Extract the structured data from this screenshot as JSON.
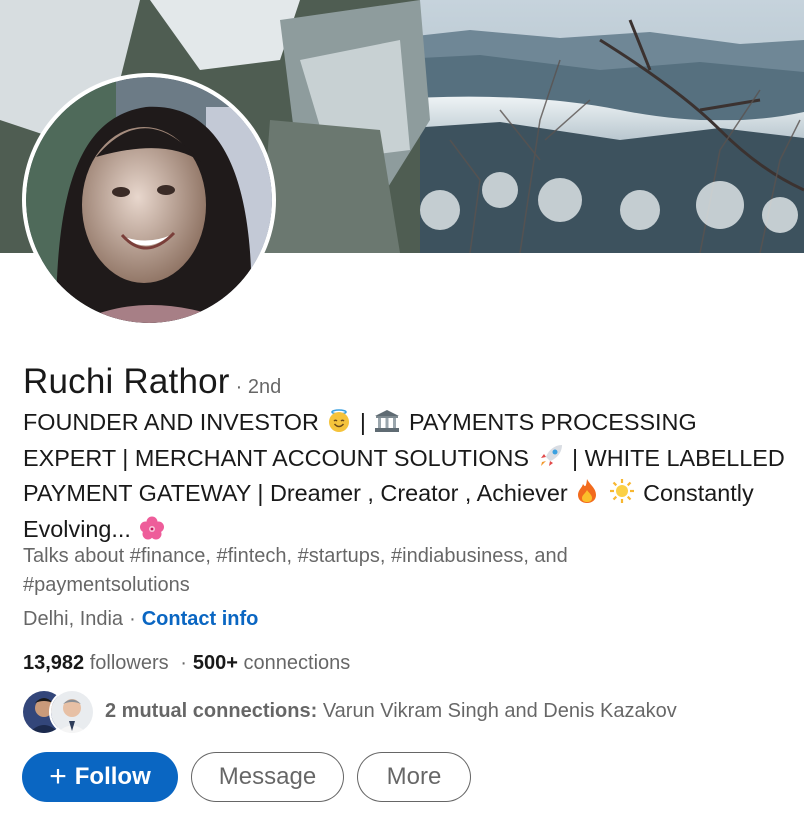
{
  "profile": {
    "name": "Ruchi Rathor",
    "degree": "· 2nd",
    "headline": {
      "part1": "FOUNDER AND INVESTOR",
      "part2": "|",
      "part3": "PAYMENTS PROCESSING EXPERT | MERCHANT ACCOUNT SOLUTIONS",
      "part4": "| WHITE LABELLED PAYMENT GATEWAY | Dreamer , Creator , Achiever",
      "part5": "Constantly Evolving...",
      "emojis": [
        "smiling-face-with-halo",
        "bank",
        "rocket",
        "fire",
        "sun",
        "hibiscus"
      ]
    },
    "talks_about": "Talks about #finance, #fintech, #startups, #indiabusiness, and #paymentsolutions",
    "location": "Delhi, India",
    "separator": "·",
    "contact_info": "Contact info",
    "followers_count": "13,982",
    "followers_label": "followers",
    "stats_separator": "·",
    "connections_count": "500+",
    "connections_label": "connections",
    "mutual": {
      "label": "2 mutual connections:",
      "names": "Varun Vikram Singh and Denis Kazakov"
    }
  },
  "actions": {
    "follow_plus": "+",
    "follow": "Follow",
    "message": "Message",
    "more": "More"
  },
  "colors": {
    "primary": "#0a66c2",
    "text": "#000000e6",
    "muted": "#00000099"
  }
}
